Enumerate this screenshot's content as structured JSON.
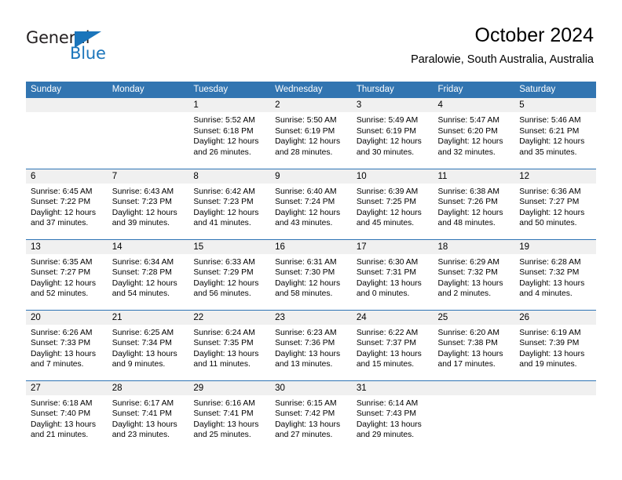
{
  "brand": {
    "name_top": "General",
    "name_bottom": "Blue",
    "accent_color": "#1b75bb"
  },
  "header": {
    "title": "October 2024",
    "subtitle": "Paralowie, South Australia, Australia"
  },
  "theme": {
    "header_blue": "#3275b1",
    "row_divider_blue": "#2e74b5",
    "daynum_band": "#f0f0f0"
  },
  "weekday_headers": [
    "Sunday",
    "Monday",
    "Tuesday",
    "Wednesday",
    "Thursday",
    "Friday",
    "Saturday"
  ],
  "labels": {
    "sunrise_prefix": "Sunrise:",
    "sunset_prefix": "Sunset:",
    "daylight_prefix": "Daylight:"
  },
  "weeks": [
    [
      {
        "day": "",
        "sunrise": "",
        "sunset": "",
        "daylight": ""
      },
      {
        "day": "",
        "sunrise": "",
        "sunset": "",
        "daylight": ""
      },
      {
        "day": "1",
        "sunrise": "Sunrise: 5:52 AM",
        "sunset": "Sunset: 6:18 PM",
        "daylight": "Daylight: 12 hours and 26 minutes."
      },
      {
        "day": "2",
        "sunrise": "Sunrise: 5:50 AM",
        "sunset": "Sunset: 6:19 PM",
        "daylight": "Daylight: 12 hours and 28 minutes."
      },
      {
        "day": "3",
        "sunrise": "Sunrise: 5:49 AM",
        "sunset": "Sunset: 6:19 PM",
        "daylight": "Daylight: 12 hours and 30 minutes."
      },
      {
        "day": "4",
        "sunrise": "Sunrise: 5:47 AM",
        "sunset": "Sunset: 6:20 PM",
        "daylight": "Daylight: 12 hours and 32 minutes."
      },
      {
        "day": "5",
        "sunrise": "Sunrise: 5:46 AM",
        "sunset": "Sunset: 6:21 PM",
        "daylight": "Daylight: 12 hours and 35 minutes."
      }
    ],
    [
      {
        "day": "6",
        "sunrise": "Sunrise: 6:45 AM",
        "sunset": "Sunset: 7:22 PM",
        "daylight": "Daylight: 12 hours and 37 minutes."
      },
      {
        "day": "7",
        "sunrise": "Sunrise: 6:43 AM",
        "sunset": "Sunset: 7:23 PM",
        "daylight": "Daylight: 12 hours and 39 minutes."
      },
      {
        "day": "8",
        "sunrise": "Sunrise: 6:42 AM",
        "sunset": "Sunset: 7:23 PM",
        "daylight": "Daylight: 12 hours and 41 minutes."
      },
      {
        "day": "9",
        "sunrise": "Sunrise: 6:40 AM",
        "sunset": "Sunset: 7:24 PM",
        "daylight": "Daylight: 12 hours and 43 minutes."
      },
      {
        "day": "10",
        "sunrise": "Sunrise: 6:39 AM",
        "sunset": "Sunset: 7:25 PM",
        "daylight": "Daylight: 12 hours and 45 minutes."
      },
      {
        "day": "11",
        "sunrise": "Sunrise: 6:38 AM",
        "sunset": "Sunset: 7:26 PM",
        "daylight": "Daylight: 12 hours and 48 minutes."
      },
      {
        "day": "12",
        "sunrise": "Sunrise: 6:36 AM",
        "sunset": "Sunset: 7:27 PM",
        "daylight": "Daylight: 12 hours and 50 minutes."
      }
    ],
    [
      {
        "day": "13",
        "sunrise": "Sunrise: 6:35 AM",
        "sunset": "Sunset: 7:27 PM",
        "daylight": "Daylight: 12 hours and 52 minutes."
      },
      {
        "day": "14",
        "sunrise": "Sunrise: 6:34 AM",
        "sunset": "Sunset: 7:28 PM",
        "daylight": "Daylight: 12 hours and 54 minutes."
      },
      {
        "day": "15",
        "sunrise": "Sunrise: 6:33 AM",
        "sunset": "Sunset: 7:29 PM",
        "daylight": "Daylight: 12 hours and 56 minutes."
      },
      {
        "day": "16",
        "sunrise": "Sunrise: 6:31 AM",
        "sunset": "Sunset: 7:30 PM",
        "daylight": "Daylight: 12 hours and 58 minutes."
      },
      {
        "day": "17",
        "sunrise": "Sunrise: 6:30 AM",
        "sunset": "Sunset: 7:31 PM",
        "daylight": "Daylight: 13 hours and 0 minutes."
      },
      {
        "day": "18",
        "sunrise": "Sunrise: 6:29 AM",
        "sunset": "Sunset: 7:32 PM",
        "daylight": "Daylight: 13 hours and 2 minutes."
      },
      {
        "day": "19",
        "sunrise": "Sunrise: 6:28 AM",
        "sunset": "Sunset: 7:32 PM",
        "daylight": "Daylight: 13 hours and 4 minutes."
      }
    ],
    [
      {
        "day": "20",
        "sunrise": "Sunrise: 6:26 AM",
        "sunset": "Sunset: 7:33 PM",
        "daylight": "Daylight: 13 hours and 7 minutes."
      },
      {
        "day": "21",
        "sunrise": "Sunrise: 6:25 AM",
        "sunset": "Sunset: 7:34 PM",
        "daylight": "Daylight: 13 hours and 9 minutes."
      },
      {
        "day": "22",
        "sunrise": "Sunrise: 6:24 AM",
        "sunset": "Sunset: 7:35 PM",
        "daylight": "Daylight: 13 hours and 11 minutes."
      },
      {
        "day": "23",
        "sunrise": "Sunrise: 6:23 AM",
        "sunset": "Sunset: 7:36 PM",
        "daylight": "Daylight: 13 hours and 13 minutes."
      },
      {
        "day": "24",
        "sunrise": "Sunrise: 6:22 AM",
        "sunset": "Sunset: 7:37 PM",
        "daylight": "Daylight: 13 hours and 15 minutes."
      },
      {
        "day": "25",
        "sunrise": "Sunrise: 6:20 AM",
        "sunset": "Sunset: 7:38 PM",
        "daylight": "Daylight: 13 hours and 17 minutes."
      },
      {
        "day": "26",
        "sunrise": "Sunrise: 6:19 AM",
        "sunset": "Sunset: 7:39 PM",
        "daylight": "Daylight: 13 hours and 19 minutes."
      }
    ],
    [
      {
        "day": "27",
        "sunrise": "Sunrise: 6:18 AM",
        "sunset": "Sunset: 7:40 PM",
        "daylight": "Daylight: 13 hours and 21 minutes."
      },
      {
        "day": "28",
        "sunrise": "Sunrise: 6:17 AM",
        "sunset": "Sunset: 7:41 PM",
        "daylight": "Daylight: 13 hours and 23 minutes."
      },
      {
        "day": "29",
        "sunrise": "Sunrise: 6:16 AM",
        "sunset": "Sunset: 7:41 PM",
        "daylight": "Daylight: 13 hours and 25 minutes."
      },
      {
        "day": "30",
        "sunrise": "Sunrise: 6:15 AM",
        "sunset": "Sunset: 7:42 PM",
        "daylight": "Daylight: 13 hours and 27 minutes."
      },
      {
        "day": "31",
        "sunrise": "Sunrise: 6:14 AM",
        "sunset": "Sunset: 7:43 PM",
        "daylight": "Daylight: 13 hours and 29 minutes."
      },
      {
        "day": "",
        "sunrise": "",
        "sunset": "",
        "daylight": ""
      },
      {
        "day": "",
        "sunrise": "",
        "sunset": "",
        "daylight": ""
      }
    ]
  ]
}
